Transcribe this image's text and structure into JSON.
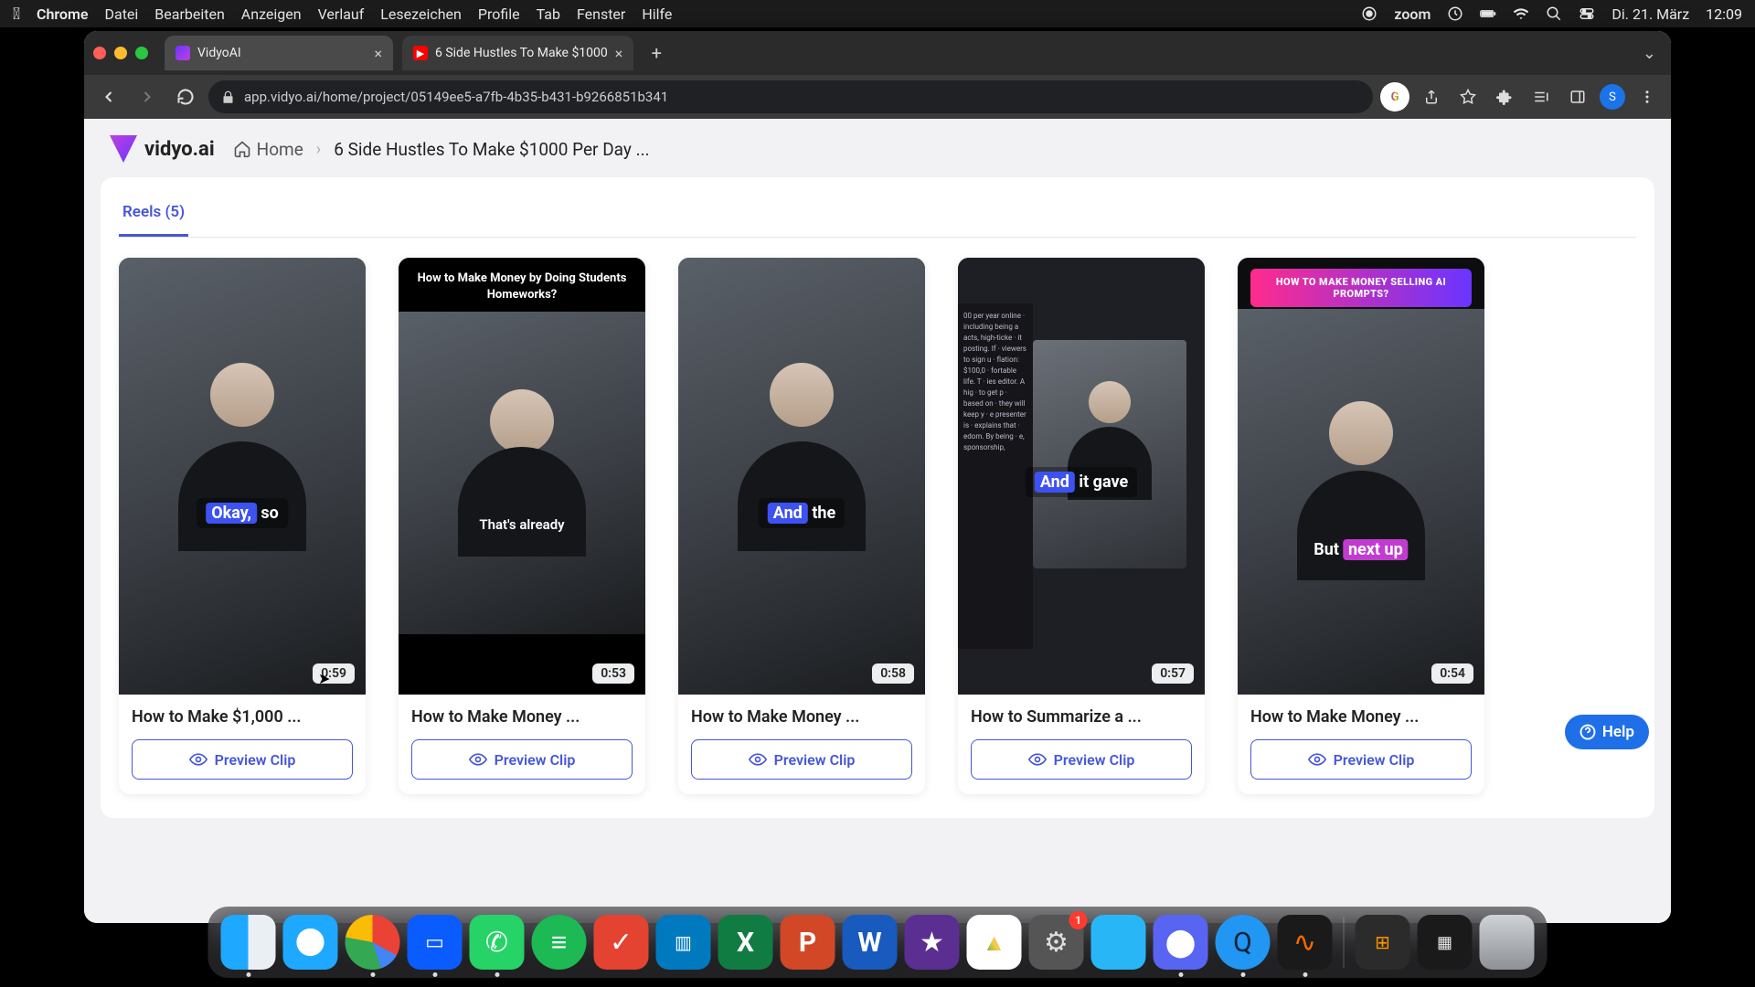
{
  "menubar": {
    "app": "Chrome",
    "items": [
      "Datei",
      "Bearbeiten",
      "Anzeigen",
      "Verlauf",
      "Lesezeichen",
      "Profile",
      "Tab",
      "Fenster",
      "Hilfe"
    ],
    "zoom_label": "zoom",
    "date": "Di. 21. März",
    "time": "12:09"
  },
  "tabs": [
    {
      "title": "VidyoAI",
      "active": true
    },
    {
      "title": "6 Side Hustles To Make $1000",
      "active": false
    }
  ],
  "url": "app.vidyo.ai/home/project/05149ee5-a7fb-4b35-b431-b9266851b341",
  "profile_initial": "S",
  "page": {
    "logo_text": "vidyo.ai",
    "breadcrumb_home": "Home",
    "breadcrumb_current": "6 Side Hustles To Make $1000 Per Day ...",
    "tab_label": "Reels (5)",
    "preview_label": "Preview Clip",
    "help_label": "Help"
  },
  "cards": [
    {
      "title": "How to Make $1,000 ...",
      "duration": "0:59",
      "caption_plain": "so",
      "caption_hilite": "Okay,",
      "style": "cap1"
    },
    {
      "title": "How to Make Money ...",
      "duration": "0:53",
      "banner": "How to Make Money by Doing Students Homeworks?",
      "caption_plain": "That's already",
      "style": "banner_black"
    },
    {
      "title": "How to Make Money ...",
      "duration": "0:58",
      "caption_plain": "the",
      "caption_hilite": "And",
      "style": "cap1"
    },
    {
      "title": "How to Summarize a ...",
      "duration": "0:57",
      "caption_plain": "it gave",
      "caption_hilite": "And",
      "style": "sidecol"
    },
    {
      "title": "How to Make Money ...",
      "duration": "0:54",
      "banner": "HOW TO MAKE MONEY SELLING AI PROMPTS?",
      "caption_plain": "But",
      "caption_hilite": "next up",
      "style": "banner_grad"
    }
  ],
  "dock_badge": "1"
}
